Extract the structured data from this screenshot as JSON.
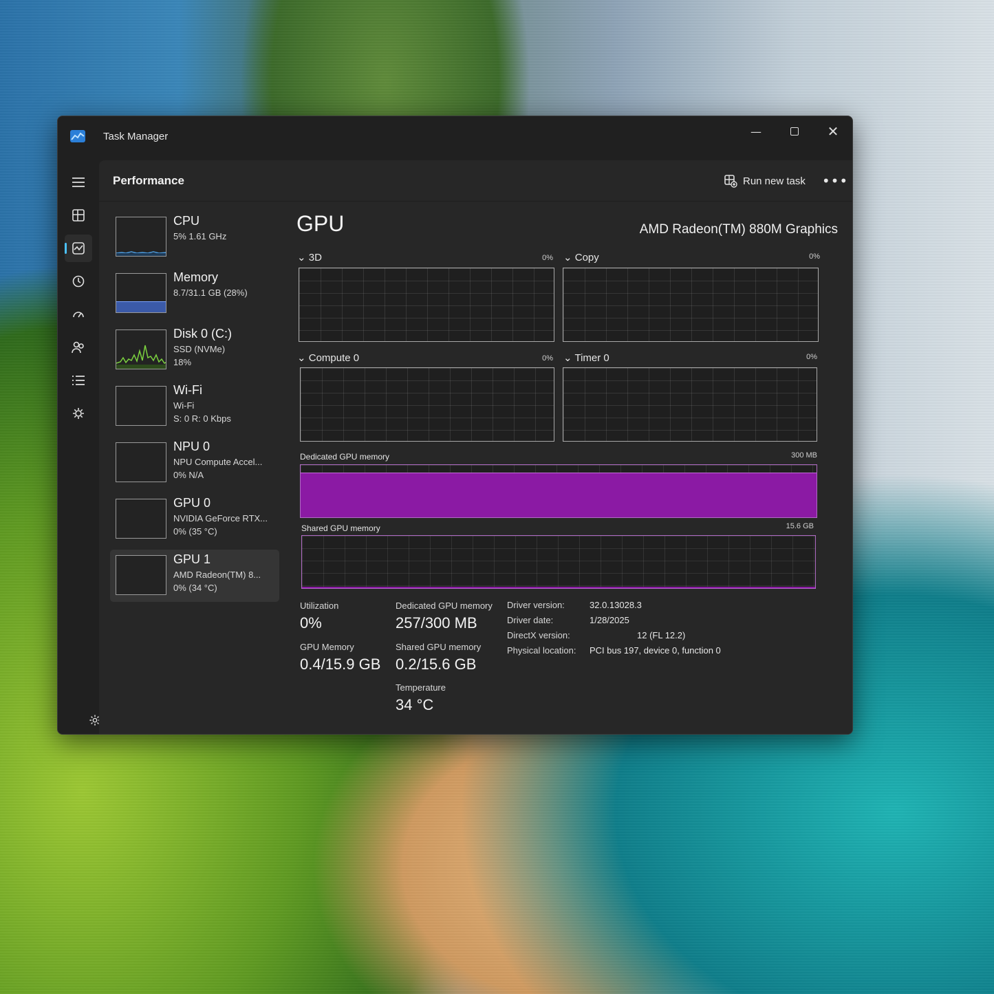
{
  "window": {
    "title": "Task Manager"
  },
  "header": {
    "page_title": "Performance",
    "run_new_task_label": "Run new task",
    "more_label": "•••"
  },
  "nav": {
    "items": [
      {
        "icon": "hamburger-menu-icon"
      },
      {
        "icon": "processes-icon"
      },
      {
        "icon": "performance-icon",
        "active": true
      },
      {
        "icon": "app-history-icon"
      },
      {
        "icon": "startup-apps-icon"
      },
      {
        "icon": "users-icon"
      },
      {
        "icon": "details-icon"
      },
      {
        "icon": "services-icon"
      }
    ],
    "settings_icon": "settings-gear-icon"
  },
  "resources": [
    {
      "name": "CPU",
      "line1": "5%  1.61 GHz",
      "line2": ""
    },
    {
      "name": "Memory",
      "line1": "8.7/31.1 GB (28%)",
      "line2": ""
    },
    {
      "name": "Disk 0 (C:)",
      "line1": "SSD (NVMe)",
      "line2": "18%"
    },
    {
      "name": "Wi-Fi",
      "line1": "Wi-Fi",
      "line2": "S: 0 R: 0 Kbps"
    },
    {
      "name": "NPU 0",
      "line1": "NPU Compute Accel...",
      "line2": "0%  N/A"
    },
    {
      "name": "GPU 0",
      "line1": "NVIDIA GeForce RTX...",
      "line2": "0%  (35 °C)"
    },
    {
      "name": "GPU 1",
      "line1": "AMD Radeon(TM) 8...",
      "line2": "0%  (34 °C)",
      "selected": true
    }
  ],
  "detail": {
    "title": "GPU",
    "model": "AMD Radeon(TM) 880M Graphics",
    "engines": [
      {
        "label": "3D",
        "percent": "0%"
      },
      {
        "label": "Copy",
        "percent": "0%"
      },
      {
        "label": "Compute 0",
        "percent": "0%"
      },
      {
        "label": "Timer 0",
        "percent": "0%"
      }
    ],
    "dedicated_memory_graph": {
      "label": "Dedicated GPU memory",
      "max": "300 MB",
      "fill_fraction": 0.86
    },
    "shared_memory_graph": {
      "label": "Shared GPU memory",
      "max": "15.6 GB",
      "fill_fraction": 0.013
    },
    "stats": {
      "utilization_label": "Utilization",
      "utilization_value": "0%",
      "dedicated_label": "Dedicated GPU memory",
      "dedicated_value": "257/300 MB",
      "gpu_memory_label": "GPU Memory",
      "gpu_memory_value": "0.4/15.9 GB",
      "shared_label": "Shared GPU memory",
      "shared_value": "0.2/15.6 GB",
      "temperature_label": "Temperature",
      "temperature_value": "34 °C"
    },
    "info": {
      "driver_version_key": "Driver version:",
      "driver_version": "32.0.13028.3",
      "driver_date_key": "Driver date:",
      "driver_date": "1/28/2025",
      "directx_key": "DirectX version:",
      "directx": "12 (FL 12.2)",
      "location_key": "Physical location:",
      "location": "PCI bus 197, device 0, function 0"
    }
  },
  "colors": {
    "accent": "#4cc2ff",
    "gpu_memory_fill": "#8b1aa4",
    "memory_thumb": "#3b5aa8",
    "disk_line": "#7bd13f",
    "cpu_line": "#4a9be0"
  }
}
